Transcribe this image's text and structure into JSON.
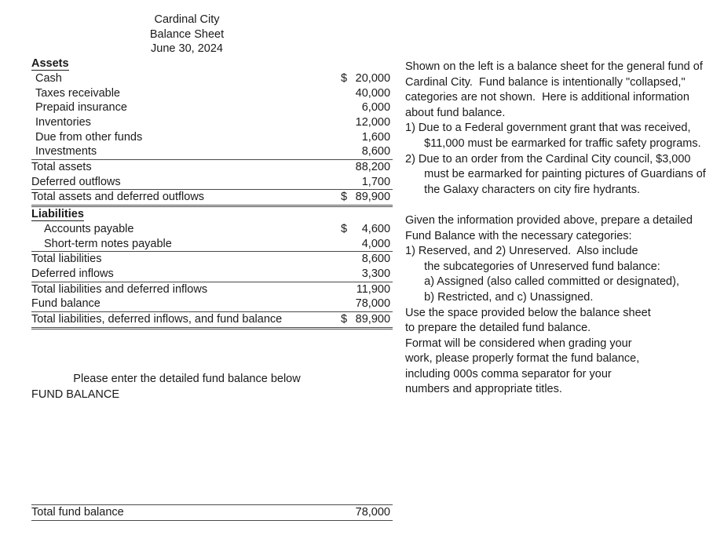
{
  "document": {
    "header": {
      "entity": "Cardinal City",
      "statement": "Balance Sheet",
      "date": "June 30, 2024"
    },
    "currency_symbol": "$",
    "sections": [
      {
        "heading": "Assets",
        "rows": [
          {
            "label": "Cash",
            "dollar": "$",
            "amount": "20,000"
          },
          {
            "label": "Taxes receivable",
            "dollar": "",
            "amount": "40,000"
          },
          {
            "label": "Prepaid insurance",
            "dollar": "",
            "amount": "6,000"
          },
          {
            "label": "Inventories",
            "dollar": "",
            "amount": "12,000"
          },
          {
            "label": "Due from other funds",
            "dollar": "",
            "amount": "1,600"
          },
          {
            "label": "Investments",
            "dollar": "",
            "amount": "8,600"
          },
          {
            "label": "Total assets",
            "dollar": "",
            "amount": "88,200"
          },
          {
            "label": "Deferred outflows",
            "dollar": "",
            "amount": "1,700"
          },
          {
            "label": "Total assets and deferred outflows",
            "dollar": "$",
            "amount": "89,900"
          }
        ]
      },
      {
        "heading": "Liabilities",
        "rows": [
          {
            "label": "Accounts payable",
            "dollar": "$",
            "amount": "4,600"
          },
          {
            "label": "Short-term notes payable",
            "dollar": "",
            "amount": "4,000"
          },
          {
            "label": "Total liabilities",
            "dollar": "",
            "amount": "8,600"
          },
          {
            "label": "Deferred inflows",
            "dollar": "",
            "amount": "3,300"
          },
          {
            "label": "Total liabilities and deferred inflows",
            "dollar": "",
            "amount": "11,900"
          },
          {
            "label": "Fund balance",
            "dollar": "",
            "amount": "78,000"
          },
          {
            "label": "Total liabilities, deferred inflows, and fund balance",
            "dollar": "$",
            "amount": "89,900"
          }
        ]
      }
    ]
  },
  "answer_area": {
    "instruction": "Please enter the detailed fund balance below",
    "section_title": "FUND BALANCE",
    "total_row": {
      "label": "Total fund balance",
      "dollar": "",
      "amount": "78,000"
    }
  },
  "notes": {
    "lines": [
      "Shown on the left is a balance sheet for the general fund of",
      "Cardinal City.  Fund balance is intentionally \"collapsed,\"",
      "categories are not shown.  Here is additional information",
      "about fund balance.",
      "1) Due to a Federal government grant that was received,",
      "      $11,000 must be earmarked for traffic safety programs.",
      "2) Due to an order from the Cardinal City council, $3,000",
      "      must be earmarked for painting pictures of Guardians of",
      "      the Galaxy characters on city fire hydrants.",
      "",
      "Given the information provided above, prepare a detailed",
      "Fund Balance with the necessary categories:",
      "1) Reserved, and 2) Unreserved.  Also include",
      "      the subcategories of Unreserved fund balance:",
      "      a) Assigned (also called committed or designated),",
      "      b) Restricted, and c) Unassigned.",
      "Use the space provided below the balance sheet",
      "to prepare the detailed fund balance.",
      "Format will be considered when grading your",
      "work, please properly format the fund balance,",
      "including 000s comma separator for your",
      "numbers and appropriate titles."
    ]
  }
}
